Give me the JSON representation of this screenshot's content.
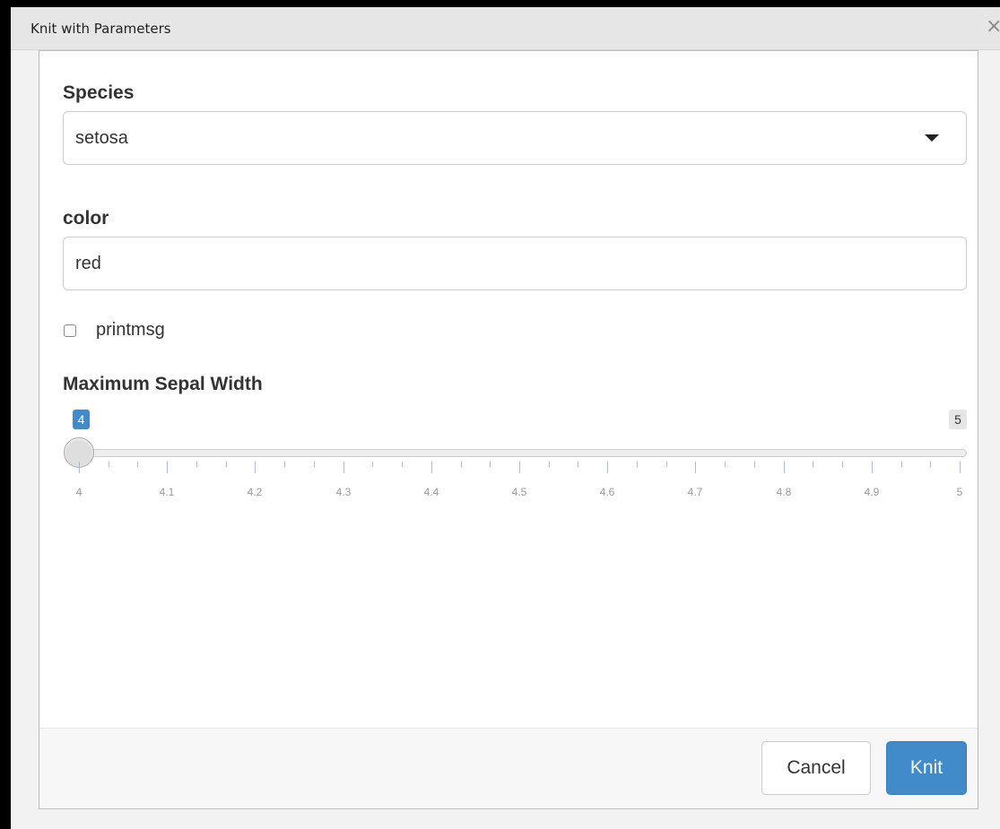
{
  "window": {
    "title": "Knit with Parameters",
    "close_glyph": "×"
  },
  "form": {
    "species": {
      "label": "Species",
      "selected": "setosa"
    },
    "color": {
      "label": "color",
      "value": "red"
    },
    "printmsg": {
      "label": "printmsg",
      "checked": false
    },
    "max_sepal_width": {
      "label": "Maximum Sepal Width",
      "min": 4,
      "max": 5,
      "value": 4,
      "value_badge": "4",
      "max_badge": "5",
      "ticks": [
        "4",
        "4.1",
        "4.2",
        "4.3",
        "4.4",
        "4.5",
        "4.6",
        "4.7",
        "4.8",
        "4.9",
        "5"
      ]
    }
  },
  "footer": {
    "cancel_label": "Cancel",
    "knit_label": "Knit"
  },
  "colors": {
    "accent": "#428bca",
    "text": "#333333",
    "tick": "#a9bed6"
  },
  "icons": {
    "select_caret": "caret-down-icon",
    "close": "close-icon"
  }
}
